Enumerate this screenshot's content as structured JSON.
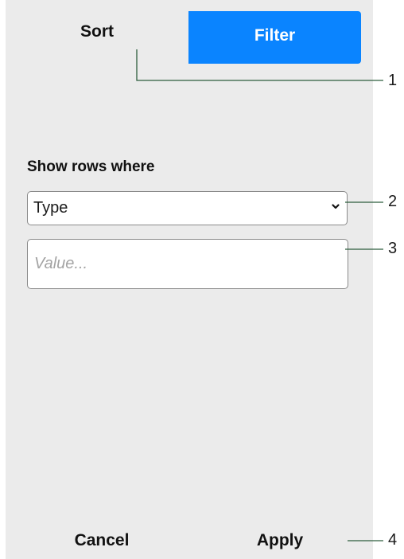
{
  "tabs": {
    "sort_label": "Sort",
    "filter_label": "Filter"
  },
  "filter": {
    "section_label": "Show rows where",
    "column_select_value": "Type",
    "value_placeholder": "Value..."
  },
  "footer": {
    "cancel_label": "Cancel",
    "apply_label": "Apply"
  },
  "callouts": [
    "1",
    "2",
    "3",
    "4"
  ],
  "colors": {
    "accent": "#0a84ff",
    "panel_background": "#ebebeb",
    "callout_line": "#2e5e3e"
  }
}
